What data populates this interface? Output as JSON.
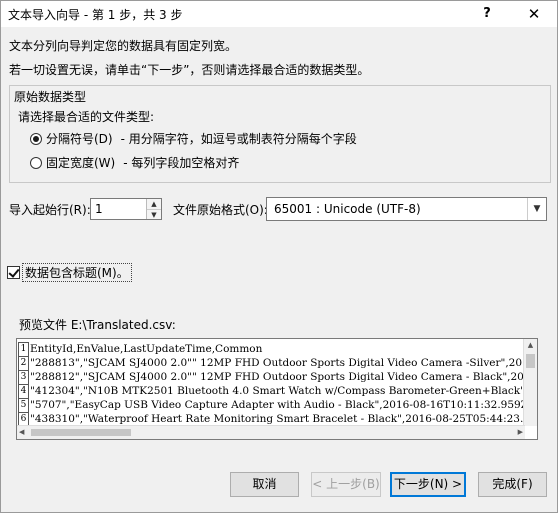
{
  "window": {
    "title": "文本导入向导 - 第 1 步，共 3 步",
    "help": "?",
    "close": "✕"
  },
  "intro": {
    "line1": "文本分列向导判定您的数据具有固定列宽。",
    "line2": "若一切设置无误，请单击“下一步”，否则请选择最合适的数据类型。"
  },
  "original_type": {
    "title": "原始数据类型",
    "prompt": "请选择最合适的文件类型:",
    "options": [
      {
        "label": "分隔符号(D)",
        "desc": "- 用分隔字符，如逗号或制表符分隔每个字段",
        "selected": true
      },
      {
        "label": "固定宽度(W)",
        "desc": "- 每列字段加空格对齐",
        "selected": false
      }
    ]
  },
  "start_row": {
    "label": "导入起始行(R):",
    "value": "1"
  },
  "file_origin": {
    "label": "文件原始格式(O):",
    "value": "65001 : Unicode (UTF-8)"
  },
  "headers_checkbox": {
    "label": "数据包含标题(M)。",
    "checked": true
  },
  "preview": {
    "label": "预览文件 E:\\Translated.csv:",
    "rows": [
      {
        "num": "1",
        "text": "EntityId,EnValue,LastUpdateTime,Common"
      },
      {
        "num": "2",
        "text": "\"288813\",\"SJCAM SJ4000 2.0\"\" 12MP FHD Outdoor Sports Digital Video Camera -Silver\",2016-09"
      },
      {
        "num": "3",
        "text": "\"288812\",\"SJCAM SJ4000 2.0\"\" 12MP FHD Outdoor Sports Digital Video Camera - Black\",2016-08"
      },
      {
        "num": "4",
        "text": "\"412304\",\"N10B MTK2501 Bluetooth 4.0 Smart Watch w/Compass Barometer-Green+Black\",2016-08-"
      },
      {
        "num": "5",
        "text": "\"5707\",\"EasyCap USB Video Capture Adapter with Audio - Black\",2016-08-16T10:11:32.959Z,\"["
      },
      {
        "num": "6",
        "text": "\"438310\",\"Waterproof Heart Rate Monitoring Smart Bracelet - Black\",2016-08-25T05:44:23.714"
      }
    ]
  },
  "buttons": {
    "cancel": "取消",
    "back": "< 上一步(B)",
    "next": "下一步(N) >",
    "finish": "完成(F)"
  }
}
